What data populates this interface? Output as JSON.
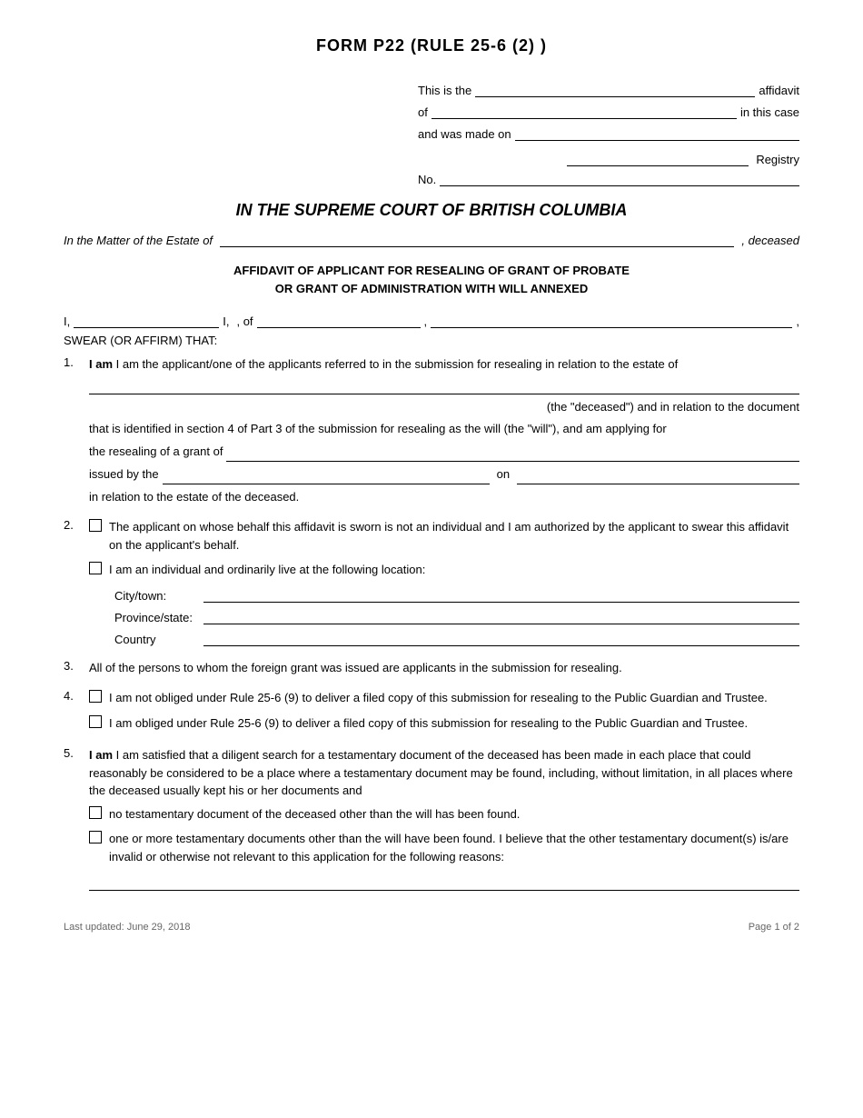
{
  "title": "FORM P22 (RULE 25-6 (2) )",
  "top_right": {
    "this_is_the": "This is the",
    "affidavit": "affidavit",
    "of": "of",
    "in_this_case": "in this case",
    "and_was_made_on": "and was made on",
    "registry": "Registry",
    "no": "No."
  },
  "court_title": "IN THE SUPREME COURT OF BRITISH COLUMBIA",
  "matter_label": "In the Matter of the Estate of",
  "matter_suffix": ", deceased",
  "affidavit_title_line1": "AFFIDAVIT OF APPLICANT FOR RESEALING OF GRANT OF PROBATE",
  "affidavit_title_line2": "OR GRANT OF ADMINISTRATION WITH WILL ANNEXED",
  "i_label": "I,",
  "of_label": ", of",
  "swear": "SWEAR (OR AFFIRM) THAT:",
  "section1": {
    "number": "1.",
    "text_start": " I am the applicant/one of the applicants referred to in the submission for resealing in relation to the estate of",
    "text_mid": "(the \"deceased\") and in relation to the document",
    "text_cont": "that is identified in section 4 of Part 3 of the submission for resealing as the will (the \"will\"), and am applying for",
    "resealing_label": "the resealing of a grant of",
    "issued_by_label": "issued by the",
    "on_label": "on",
    "in_relation": "in relation to the estate of the deceased."
  },
  "section2": {
    "number": "2.",
    "checkbox1_text": "The applicant on whose behalf this affidavit is sworn is not an individual and I am authorized by the applicant to swear this affidavit on the applicant's behalf.",
    "checkbox2_text": "I am an individual and ordinarily live at the following location:",
    "city_label": "City/town:",
    "province_label": "Province/state:",
    "country_label": "Country"
  },
  "section3": {
    "number": "3.",
    "text": "All of the persons to whom the foreign grant was issued are applicants in the submission for resealing."
  },
  "section4": {
    "number": "4.",
    "checkbox1_text": "I am not obliged under Rule 25-6 (9) to deliver a filed copy of this submission for resealing to the Public Guardian and Trustee.",
    "checkbox2_text": "I am obliged under Rule 25-6 (9) to deliver a filed copy of this submission for resealing to the Public Guardian and Trustee."
  },
  "section5": {
    "number": "5.",
    "text_intro": " I am satisfied that a diligent search for a testamentary document of the deceased has been made in each place that could reasonably be considered to be a place where a testamentary document may be found, including, without limitation, in all places where the deceased usually kept his or her documents and",
    "checkbox1_text": "no testamentary document of the deceased other than the will has been found.",
    "checkbox2_text": "one or more testamentary documents other than the will have been found.",
    "checkbox2_cont": " I believe that the other testamentary document(s) is/are invalid or otherwise not relevant to this application for the following reasons:"
  },
  "footer": {
    "last_updated": "Last updated: June 29, 2018",
    "page": "Page 1 of 2"
  }
}
